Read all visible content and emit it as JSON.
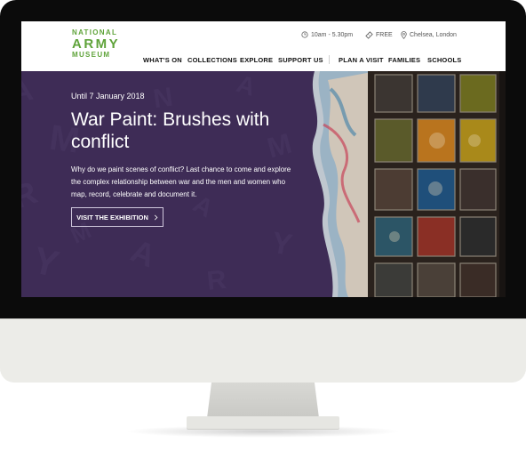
{
  "logo": {
    "line1": "NATIONAL",
    "line2": "ARMY",
    "line3": "MUSEUM"
  },
  "header_info": {
    "hours": "10am - 5.30pm",
    "price": "FREE",
    "location": "Chelsea, London",
    "hours_icon": "clock-icon",
    "price_icon": "ticket-icon",
    "location_icon": "map-pin-icon"
  },
  "nav": {
    "items": [
      "WHAT'S ON",
      "COLLECTIONS",
      "EXPLORE",
      "SUPPORT US",
      "PLAN A VISIT",
      "FAMILIES",
      "SCHOOLS"
    ]
  },
  "hero": {
    "eyebrow": "Until 7 January 2018",
    "title": "War Paint: Brushes with conflict",
    "description": "Why do we paint scenes of conflict? Last chance to come and explore the complex relationship between war and the men and women who map, record, celebrate and document it.",
    "cta_label": "VISIT THE EXHIBITION",
    "cta_icon": "chevron-right-icon"
  },
  "colors": {
    "brand_green": "#5fa33a",
    "hero_purple": "#3e2c56",
    "text_dark": "#111111",
    "muted_text": "#555555"
  }
}
